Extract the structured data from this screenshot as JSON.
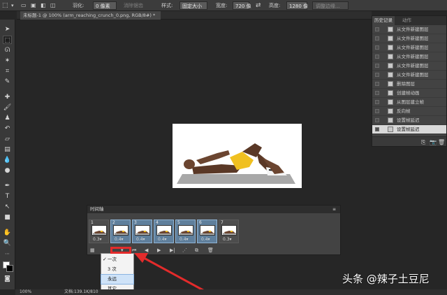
{
  "options_bar": {
    "feather_label": "羽化:",
    "feather_value": "0 像素",
    "antialias_label": "消除锯齿",
    "style_label": "样式:",
    "style_value": "固定大小",
    "width_label": "宽度:",
    "width_value": "720 像",
    "height_label": "高度:",
    "height_value": "1280 像",
    "refine_label": "调整边缘..."
  },
  "document_tab": {
    "title": "未标题-1 @ 100% (arm_reaching_crunch_0.png, RGB/8#) *"
  },
  "history_panel": {
    "tabs": [
      "历史记录",
      "动作"
    ],
    "items": [
      {
        "label": "从文件新建图层",
        "selected": false
      },
      {
        "label": "从文件新建图层",
        "selected": false
      },
      {
        "label": "从文件新建图层",
        "selected": false
      },
      {
        "label": "从文件新建图层",
        "selected": false
      },
      {
        "label": "从文件新建图层",
        "selected": false
      },
      {
        "label": "从文件新建图层",
        "selected": false
      },
      {
        "label": "删除图层",
        "selected": false
      },
      {
        "label": "创建帧动画",
        "selected": false
      },
      {
        "label": "从图层建立帧",
        "selected": false
      },
      {
        "label": "反向帧",
        "selected": false
      },
      {
        "label": "设置帧延迟",
        "selected": false
      },
      {
        "label": "设置帧延迟",
        "selected": true
      }
    ]
  },
  "timeline": {
    "title": "时间轴",
    "frames": [
      {
        "number": "1",
        "delay": "0.3",
        "selected": false
      },
      {
        "number": "2",
        "delay": "0.4",
        "selected": true
      },
      {
        "number": "3",
        "delay": "0.4",
        "selected": true
      },
      {
        "number": "4",
        "delay": "0.4",
        "selected": true
      },
      {
        "number": "5",
        "delay": "0.4",
        "selected": true
      },
      {
        "number": "6",
        "delay": "0.4",
        "selected": true
      },
      {
        "number": "7",
        "delay": "0.3",
        "selected": false
      }
    ]
  },
  "loop_menu": {
    "options": [
      {
        "label": "一次",
        "checked": true,
        "highlighted": false
      },
      {
        "label": "3 次",
        "checked": false,
        "highlighted": false
      },
      {
        "label": "永远",
        "checked": false,
        "highlighted": true
      },
      {
        "label": "其它...",
        "checked": false,
        "highlighted": false
      }
    ]
  },
  "status_bar": {
    "zoom": "100%",
    "doc_info": "文档:139.1K/810"
  },
  "watermark": {
    "text": "头条 @辣子土豆尼"
  },
  "colors": {
    "annotation_red": "#e32b2b",
    "foreground_swatch": "#ffffff",
    "background_swatch": "#000000",
    "frame_selected": "#5f7f9c"
  }
}
